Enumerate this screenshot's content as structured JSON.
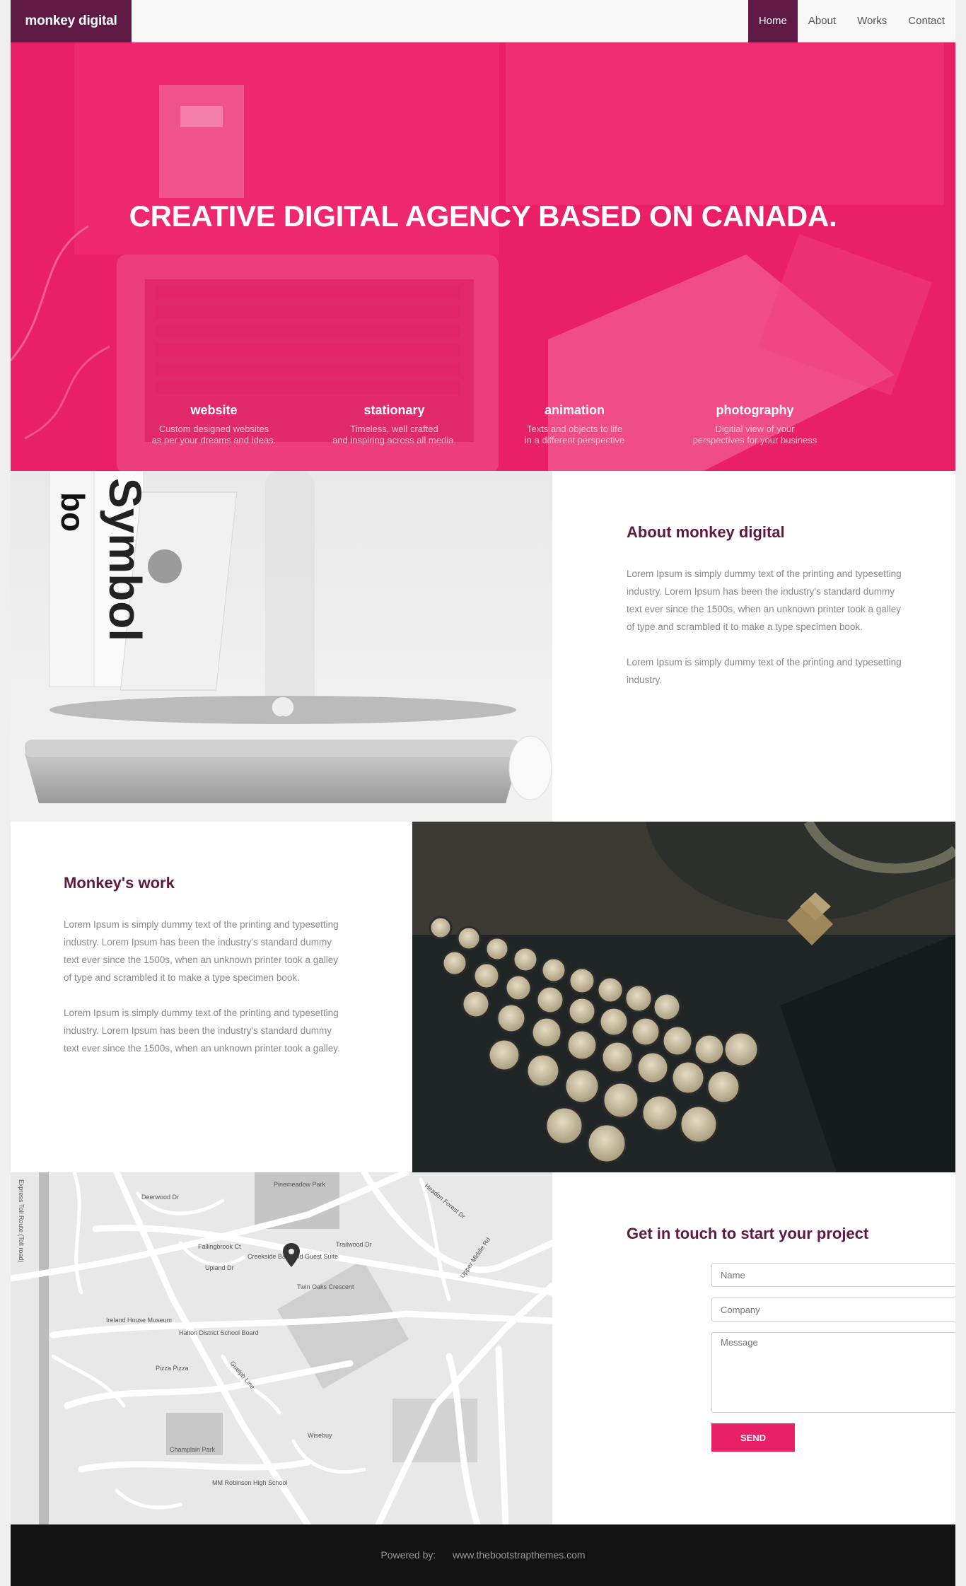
{
  "brand": "monkey digital",
  "nav": {
    "items": [
      {
        "label": "Home",
        "active": true
      },
      {
        "label": "About",
        "active": false
      },
      {
        "label": "Works",
        "active": false
      },
      {
        "label": "Contact",
        "active": false
      }
    ]
  },
  "hero": {
    "title": "CREATIVE DIGITAL AGENCY BASED ON CANADA.",
    "features": [
      {
        "title": "website",
        "line1": "Custom designed websites",
        "line2": "as per your dreams and ideas."
      },
      {
        "title": "stationary",
        "line1": "Timeless, well crafted",
        "line2": "and inspiring across all media."
      },
      {
        "title": "animation",
        "line1": "Texts and objects to life",
        "line2": "in a different perspective"
      },
      {
        "title": "photography",
        "line1": "Digitial view of your",
        "line2": "perspectives for your business"
      }
    ]
  },
  "about": {
    "title": "About monkey digital",
    "p1": "Lorem Ipsum is simply dummy text of the printing and typesetting industry. Lorem Ipsum has been the industry's standard dummy text ever since the 1500s, when an unknown printer took a galley of type and scrambled it to make a type specimen book.",
    "p2": "Lorem Ipsum is simply dummy text of the printing and typesetting industry."
  },
  "work": {
    "title": "Monkey's work",
    "p1": "Lorem Ipsum is simply dummy text of the printing and typesetting industry. Lorem Ipsum has been the industry's standard dummy text ever since the 1500s, when an unknown printer took a galley of type and scrambled it to make a type specimen book.",
    "p2": "Lorem Ipsum is simply dummy text of the printing and typesetting industry. Lorem Ipsum has been the industry's standard dummy text ever since the 1500s, when an unknown printer took a galley."
  },
  "map": {
    "labels": [
      "Deerwood Dr",
      "Fallingbrook Ct",
      "Upland Dr",
      "Pinemeadow Park",
      "Trailwood Dr",
      "Twin Oaks Crescent",
      "Upper Middle Rd",
      "Guelph Line",
      "Headon Forest Dr",
      "Ireland House Museum",
      "Halton District School Board",
      "Pizza Pizza",
      "Champlain Park",
      "MM Robinson High School",
      "Wisebuy",
      "Express Toll Route (Toll road)",
      "Creekside B&B and Guest Suite"
    ]
  },
  "contact": {
    "title": "Get in touch to start your project",
    "name_placeholder": "Name",
    "company_placeholder": "Company",
    "message_placeholder": "Message",
    "send_label": "SEND"
  },
  "footer": {
    "powered": "Powered by:",
    "link": "www.thebootstrapthemes.com"
  },
  "colors": {
    "brand": "#5e1a45",
    "accent": "#ea2066",
    "footer_bg": "#121212"
  }
}
